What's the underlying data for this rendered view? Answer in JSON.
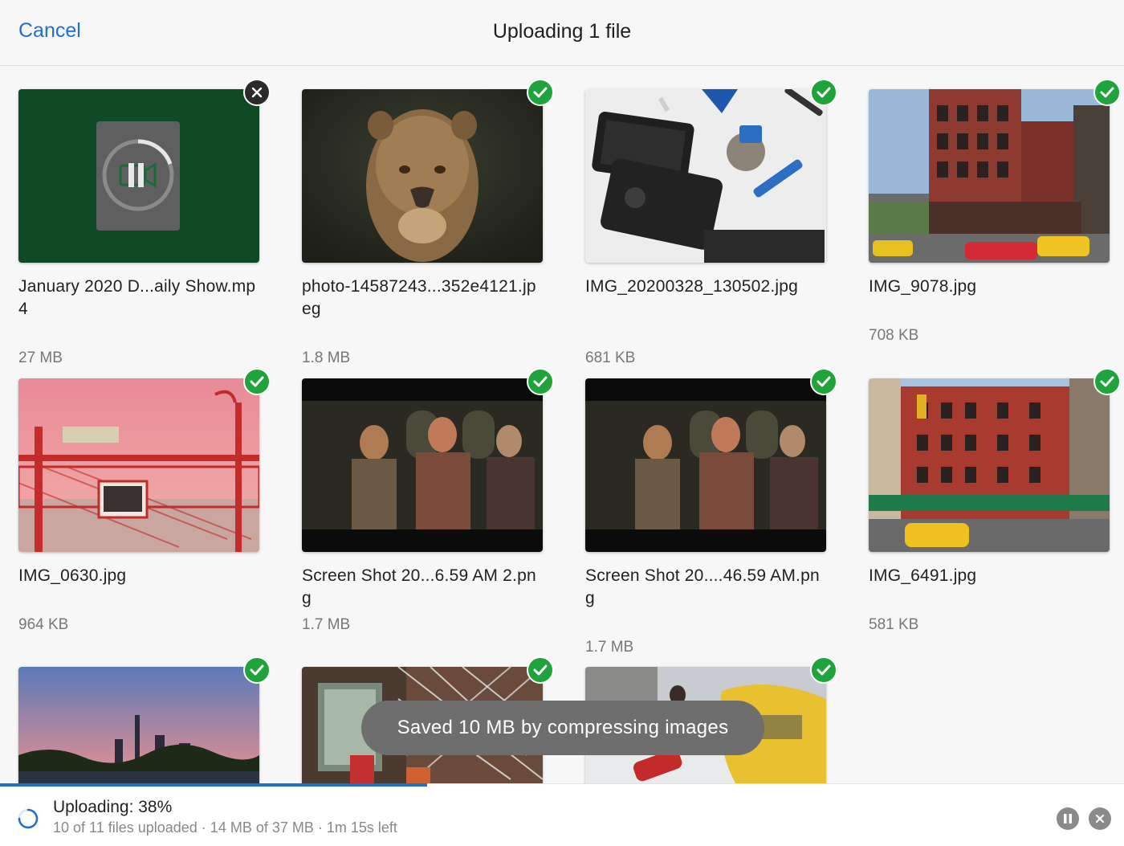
{
  "header": {
    "cancel_label": "Cancel",
    "title": "Uploading 1 file"
  },
  "files": [
    {
      "name": "January 2020 D...aily Show.mp4",
      "size": "27 MB",
      "status": "uploading"
    },
    {
      "name": "photo-14587243...352e4121.jpeg",
      "size": "1.8 MB",
      "status": "done"
    },
    {
      "name": "IMG_20200328_130502.jpg",
      "size": "681 KB",
      "status": "done"
    },
    {
      "name": "IMG_9078.jpg",
      "size": "708 KB",
      "status": "done"
    },
    {
      "name": "IMG_0630.jpg",
      "size": "964 KB",
      "status": "done"
    },
    {
      "name": "Screen Shot 20...6.59 AM 2.png",
      "size": "1.7 MB",
      "status": "done"
    },
    {
      "name": "Screen Shot 20....46.59 AM.png",
      "size": "1.7 MB",
      "status": "done"
    },
    {
      "name": "IMG_6491.jpg",
      "size": "581 KB",
      "status": "done"
    },
    {
      "status": "done"
    },
    {
      "status": "done"
    },
    {
      "status": "done"
    }
  ],
  "toast": {
    "message": "Saved 10 MB by compressing images"
  },
  "footer": {
    "title": "Uploading: 38%",
    "detail": "10 of 11 files uploaded · 14 MB of 37 MB · 1m 15s left",
    "progress_percent": 38
  },
  "colors": {
    "accent": "#1f6fd1",
    "success": "#1fa33b",
    "toast_bg": "#6e6e6e"
  },
  "icons": {
    "check": "check-icon",
    "remove": "close-icon",
    "pause_video": "video-pause-icon",
    "pause": "pause-icon",
    "cancel": "close-icon"
  }
}
